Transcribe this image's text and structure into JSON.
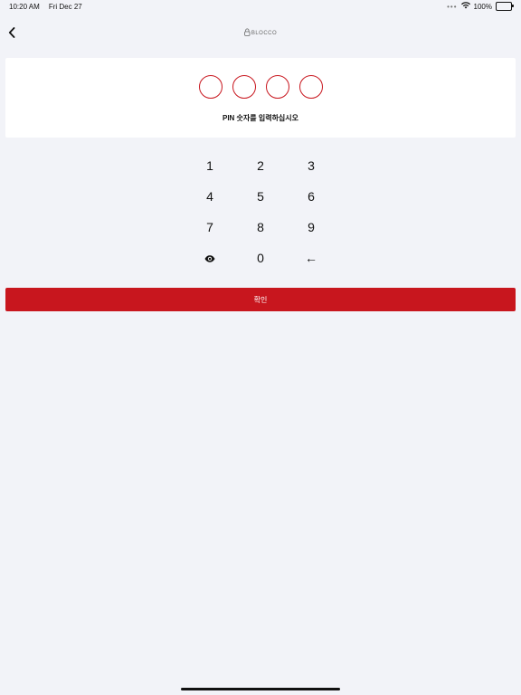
{
  "status_bar": {
    "time": "10:20 AM",
    "date": "Fri Dec 27",
    "dots": "•••",
    "battery_percent": "100%"
  },
  "nav": {
    "back_icon": "chevron-left-icon",
    "logo_text": "BLOCCO",
    "logo_icon": "lock-icon"
  },
  "pin": {
    "length": 4,
    "prompt": "PIN 숫자를 입력하십시오"
  },
  "keypad": {
    "keys": [
      "1",
      "2",
      "3",
      "4",
      "5",
      "6",
      "7",
      "8",
      "9",
      "0"
    ],
    "visibility_icon": "eye-icon",
    "backspace_label": "←"
  },
  "confirm": {
    "label": "확인"
  },
  "colors": {
    "accent": "#c8161e",
    "background": "#f2f3f8",
    "card": "#ffffff"
  }
}
